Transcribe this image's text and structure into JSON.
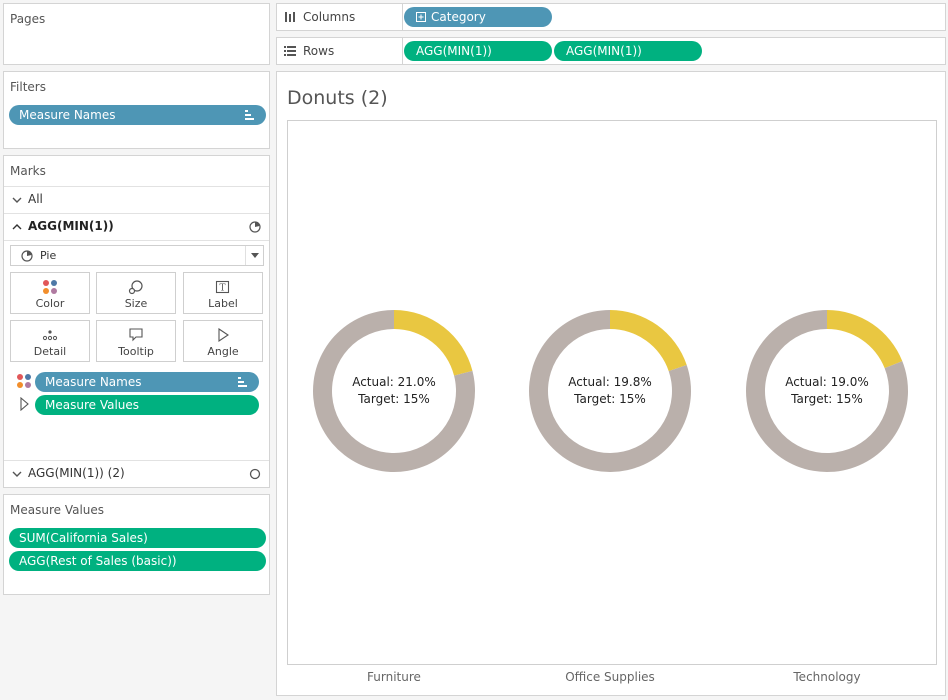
{
  "pages": {
    "title": "Pages"
  },
  "filters": {
    "title": "Filters",
    "pill": "Measure Names"
  },
  "marks": {
    "title": "Marks",
    "all_label": "All",
    "layer1_label": "AGG(MIN(1))",
    "mark_type": "Pie",
    "buttons": {
      "color": "Color",
      "size": "Size",
      "label": "Label",
      "detail": "Detail",
      "tooltip": "Tooltip",
      "angle": "Angle"
    },
    "color_pill": "Measure Names",
    "angle_pill": "Measure Values",
    "layer2_label": "AGG(MIN(1)) (2)"
  },
  "measure_values": {
    "title": "Measure Values",
    "items": [
      "SUM(California Sales)",
      "AGG(Rest of Sales (basic))"
    ]
  },
  "shelves": {
    "columns_label": "Columns",
    "columns_pill": "Category",
    "rows_label": "Rows",
    "rows_pills": [
      "AGG(MIN(1))",
      "AGG(MIN(1))"
    ]
  },
  "sheet": {
    "title": "Donuts (2)"
  },
  "colors": {
    "actual": "#e9c741",
    "rest": "#bab0ab",
    "pill_blue": "#4e96b5",
    "pill_green": "#00b180"
  },
  "chart_data": {
    "type": "pie",
    "categories": [
      "Furniture",
      "Office Supplies",
      "Technology"
    ],
    "series": [
      {
        "values": [
          21.0,
          19.8,
          19.0
        ]
      },
      {
        "values": [
          79.0,
          80.2,
          81.0
        ]
      }
    ],
    "labels": [
      {
        "actual": "Actual: 21.0%",
        "target": "Target: 15%"
      },
      {
        "actual": "Actual: 19.8%",
        "target": "Target: 15%"
      },
      {
        "actual": "Actual: 19.0%",
        "target": "Target: 15%"
      }
    ]
  }
}
